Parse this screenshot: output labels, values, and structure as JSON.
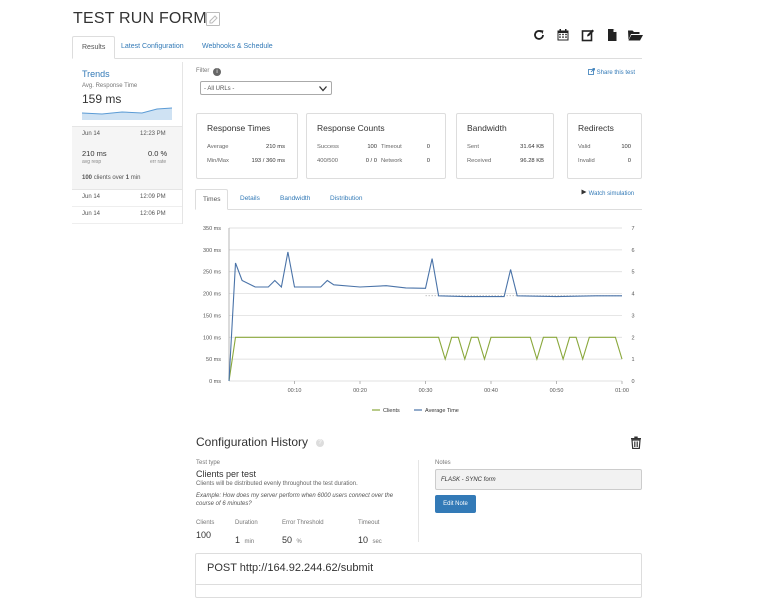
{
  "page": {
    "title": "TEST RUN FORM"
  },
  "top_tabs": [
    "Results",
    "Latest Configuration",
    "Webhooks & Schedule"
  ],
  "toolbar": {
    "icons": [
      "refresh-icon",
      "calendar-icon",
      "edit-icon",
      "file-icon",
      "folder-open-icon"
    ]
  },
  "sidebar": {
    "trends_title": "Trends",
    "trends_sub": "Avg. Response Time",
    "trends_value": "159 ms",
    "selected_run": {
      "date": "Jun 14",
      "time": "12:23 PM",
      "resp_value": "210 ms",
      "resp_label": "avg resp",
      "err_value": "0.0 %",
      "err_label": "err rate",
      "clients_num": "100",
      "clients_text": "clients over",
      "duration_num": "1",
      "duration_unit": "min"
    },
    "runs": [
      {
        "date": "Jun 14",
        "time": "12:09 PM"
      },
      {
        "date": "Jun 14",
        "time": "12:06 PM"
      }
    ]
  },
  "filter": {
    "label": "Filter",
    "info": "i",
    "selected": "- All URLs -"
  },
  "share_label": "Share this test",
  "cards": {
    "response_times": {
      "title": "Response Times",
      "average_label": "Average",
      "average": "210 ms",
      "minmax_label": "Min/Max",
      "minmax": "193 / 360 ms"
    },
    "response_counts": {
      "title": "Response Counts",
      "success_label": "Success",
      "success": "100",
      "timeout_label": "Timeout",
      "timeout": "0",
      "err_label": "400/500",
      "err": "0 / 0",
      "network_label": "Network",
      "network": "0"
    },
    "bandwidth": {
      "title": "Bandwidth",
      "sent_label": "Sent",
      "sent": "31.64 KB",
      "received_label": "Received",
      "received": "96.28 KB"
    },
    "redirects": {
      "title": "Redirects",
      "valid_label": "Valid",
      "valid": "100",
      "invalid_label": "Invalid",
      "invalid": "0"
    }
  },
  "sub_tabs": [
    "Times",
    "Details",
    "Bandwidth",
    "Distribution"
  ],
  "watch_label": "Watch simulation",
  "chart_data": {
    "type": "line",
    "y_left_ticks": [
      "350 ms",
      "300 ms",
      "250 ms",
      "200 ms",
      "150 ms",
      "100 ms",
      "50 ms",
      "0 ms"
    ],
    "y_right_ticks": [
      "7",
      "6",
      "5",
      "4",
      "3",
      "2",
      "1",
      "0"
    ],
    "x_ticks": [
      "00:10",
      "00:20",
      "00:30",
      "00:40",
      "00:50",
      "01:00"
    ],
    "ylim": [
      0,
      350
    ],
    "y2lim": [
      0,
      7
    ],
    "xlim": [
      0,
      60
    ],
    "legend": [
      "Clients",
      "Average Time"
    ],
    "colors": {
      "clients": "#8aa83c",
      "avg": "#4a73a8",
      "grid": "#d8d8d8",
      "ref": "#b0b0b0"
    },
    "series": [
      {
        "name": "Average Time",
        "points": [
          [
            0,
            0
          ],
          [
            1,
            270
          ],
          [
            2,
            230
          ],
          [
            4,
            215
          ],
          [
            6,
            215
          ],
          [
            7,
            230
          ],
          [
            8,
            215
          ],
          [
            9,
            295
          ],
          [
            10,
            215
          ],
          [
            14,
            215
          ],
          [
            15,
            230
          ],
          [
            16,
            220
          ],
          [
            20,
            215
          ],
          [
            24,
            218
          ],
          [
            27,
            213
          ],
          [
            30,
            212
          ],
          [
            31,
            280
          ],
          [
            32,
            195
          ],
          [
            36,
            193
          ],
          [
            42,
            193
          ],
          [
            43,
            255
          ],
          [
            44,
            195
          ],
          [
            50,
            193
          ],
          [
            56,
            195
          ],
          [
            60,
            195
          ]
        ]
      },
      {
        "name": "Clients",
        "points": [
          [
            0,
            0
          ],
          [
            1,
            2
          ],
          [
            32,
            2
          ],
          [
            33,
            1
          ],
          [
            34,
            2
          ],
          [
            35,
            2
          ],
          [
            36,
            1
          ],
          [
            37,
            2
          ],
          [
            38,
            2
          ],
          [
            39,
            1
          ],
          [
            40,
            2
          ],
          [
            41,
            2
          ],
          [
            46,
            2
          ],
          [
            47,
            1
          ],
          [
            48,
            2
          ],
          [
            50,
            2
          ],
          [
            51,
            1
          ],
          [
            52,
            2
          ],
          [
            53,
            2
          ],
          [
            54,
            1
          ],
          [
            55,
            2
          ],
          [
            58,
            2
          ],
          [
            59,
            2
          ],
          [
            60,
            1
          ]
        ]
      }
    ],
    "reference_line": 195
  },
  "config": {
    "title": "Configuration History",
    "test_type_label": "Test type",
    "test_type": "Clients per test",
    "test_type_desc": "Clients will be distributed evenly throughout the test duration.",
    "example": "Example: How does my server perform when 6000 users connect over the course of 6 minutes?",
    "clients_label": "Clients",
    "clients": "100",
    "duration_label": "Duration",
    "duration": "1",
    "duration_unit": "min",
    "threshold_label": "Error Threshold",
    "threshold": "50",
    "threshold_unit": "%",
    "timeout_label": "Timeout",
    "timeout": "10",
    "timeout_unit": "sec",
    "notes_label": "Notes",
    "notes": "FLASK - SYNC form",
    "edit_note": "Edit Note"
  },
  "post": {
    "text": "POST http://164.92.244.62/submit"
  }
}
